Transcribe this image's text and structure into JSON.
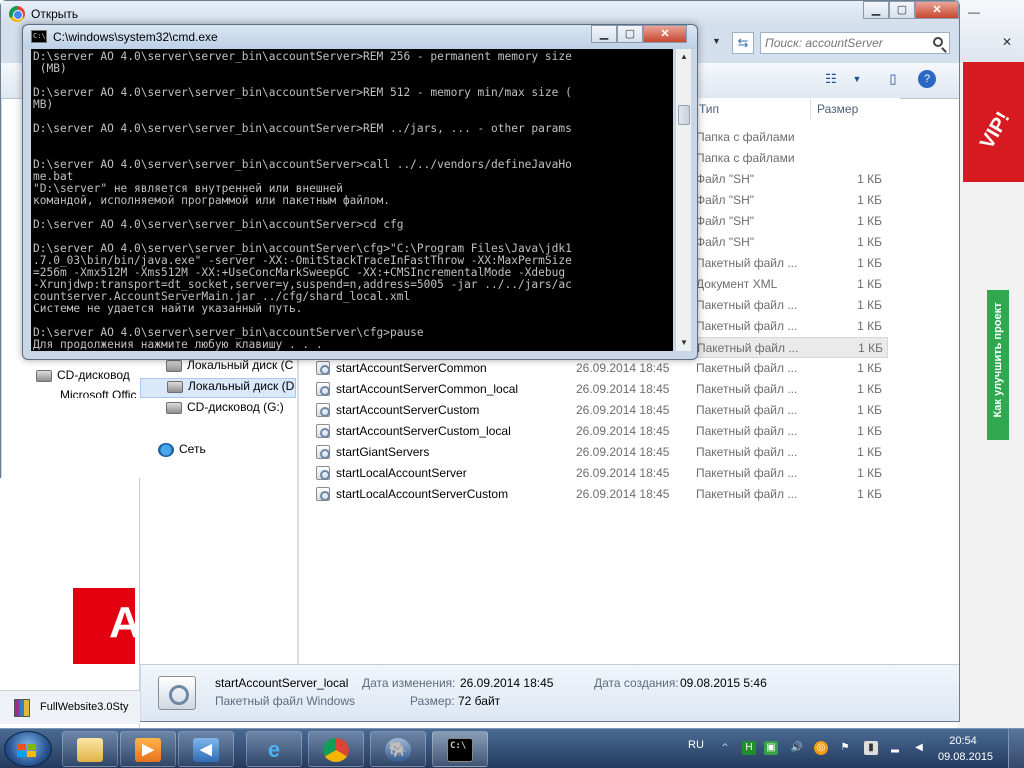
{
  "explorer": {
    "title": "Открыть",
    "search_placeholder": "Поиск: accountServer",
    "columns": {
      "type": "Тип",
      "size": "Размер"
    },
    "nav_items": [
      {
        "label": "CD-дисковод"
      },
      {
        "label": "Microsoft Office"
      },
      {
        "label": "Локальный диск (C"
      },
      {
        "label": "Локальный диск (D"
      },
      {
        "label": "CD-дисковод (G:)"
      },
      {
        "label": "Сеть"
      }
    ],
    "rows_top": [
      {
        "type": "Папка с файлами",
        "size": ""
      },
      {
        "type": "Папка с файлами",
        "size": ""
      },
      {
        "type": "Файл \"SH\"",
        "size": "1 КБ"
      },
      {
        "type": "Файл \"SH\"",
        "size": "1 КБ"
      },
      {
        "type": "Файл \"SH\"",
        "size": "1 КБ"
      },
      {
        "type": "Файл \"SH\"",
        "size": "1 КБ"
      },
      {
        "type": "Пакетный файл ...",
        "size": "1 КБ"
      },
      {
        "type": "Документ XML",
        "size": "1 КБ"
      },
      {
        "type": "Пакетный файл ...",
        "size": "1 КБ"
      },
      {
        "type": "Пакетный файл ...",
        "size": "1 КБ"
      },
      {
        "type": "Пакетный файл ...",
        "size": "1 КБ"
      }
    ],
    "rows": [
      {
        "name": "startAccountServerCommon",
        "date": "26.09.2014 18:45",
        "type": "Пакетный файл ...",
        "size": "1 КБ"
      },
      {
        "name": "startAccountServerCommon_local",
        "date": "26.09.2014 18:45",
        "type": "Пакетный файл ...",
        "size": "1 КБ"
      },
      {
        "name": "startAccountServerCustom",
        "date": "26.09.2014 18:45",
        "type": "Пакетный файл ...",
        "size": "1 КБ"
      },
      {
        "name": "startAccountServerCustom_local",
        "date": "26.09.2014 18:45",
        "type": "Пакетный файл ...",
        "size": "1 КБ"
      },
      {
        "name": "startGiantServers",
        "date": "26.09.2014 18:45",
        "type": "Пакетный файл ...",
        "size": "1 КБ"
      },
      {
        "name": "startLocalAccountServer",
        "date": "26.09.2014 18:45",
        "type": "Пакетный файл ...",
        "size": "1 КБ"
      },
      {
        "name": "startLocalAccountServerCustom",
        "date": "26.09.2014 18:45",
        "type": "Пакетный файл ...",
        "size": "1 КБ"
      }
    ],
    "details": {
      "filename": "startAccountServer_local",
      "filetype": "Пакетный файл Windows",
      "modified_label": "Дата изменения:",
      "modified_value": "26.09.2014 18:45",
      "created_label": "Дата создания:",
      "created_value": "09.08.2015 5:46",
      "size_label": "Размер:",
      "size_value": "72 байт"
    }
  },
  "cmd": {
    "title": "C:\\windows\\system32\\cmd.exe",
    "icon_text": "C:\\",
    "output": "D:\\server AO 4.0\\server\\server_bin\\accountServer>REM 256 - permanent memory size\n (MB)\n\nD:\\server AO 4.0\\server\\server_bin\\accountServer>REM 512 - memory min/max size (\nMB)\n\nD:\\server AO 4.0\\server\\server_bin\\accountServer>REM ../jars, ... - other params\n\n\nD:\\server AO 4.0\\server\\server_bin\\accountServer>call ../../vendors/defineJavaHo\nme.bat\n\"D:\\server\" не является внутренней или внешней\nкомандой, исполняемой программой или пакетным файлом.\n\nD:\\server AO 4.0\\server\\server_bin\\accountServer>cd cfg\n\nD:\\server AO 4.0\\server\\server_bin\\accountServer\\cfg>\"C:\\Program Files\\Java\\jdk1\n.7.0_03\\bin/bin/java.exe\" -server -XX:-OmitStackTraceInFastThrow -XX:MaxPermSize\n=256m -Xmx512M -Xms512M -XX:+UseConcMarkSweepGC -XX:+CMSIncrementalMode -Xdebug \n-Xrunjdwp:transport=dt_socket,server=y,suspend=n,address=5005 -jar ../../jars/ac\ncountserver.AccountServerMain.jar ../cfg/shard_local.xml\nСистеме не удается найти указанный путь.\n\nD:\\server AO 4.0\\server\\server_bin\\accountServer\\cfg>pause\nДля продолжения нажмите любую клавишу . . ."
  },
  "right_page": {
    "vip": "VIP!",
    "improve": "Как улучшить проект"
  },
  "left_bg": {
    "red_letter": "A"
  },
  "taskbar": {
    "bg_task": "FullWebsite3.0Sty",
    "lang": "RU",
    "time": "20:54",
    "date": "09.08.2015"
  },
  "colors": {
    "cmd_bg": "#000000",
    "cmd_fg": "#c0c0c0",
    "accent": "#2fa84f",
    "vip_red": "#d71920"
  }
}
